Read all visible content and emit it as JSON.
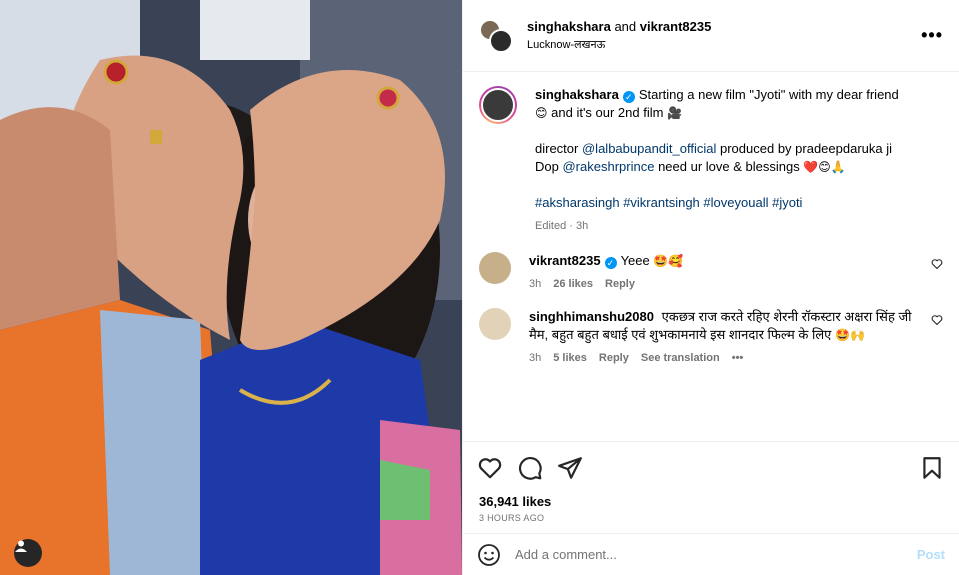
{
  "header": {
    "user1": "singhakshara",
    "and": "and",
    "user2": "vikrant8235",
    "location": "Lucknow-लखनऊ",
    "more": "•••"
  },
  "caption": {
    "username": "singhakshara",
    "line1": "Starting a new film \"Jyoti\" with my dear friend",
    "emoji1": "😊",
    "line1b": "and it's our 2nd film",
    "emoji2": "🎥",
    "director_prefix": "director",
    "director_handle": "@lalbabupandit_official",
    "produced": "produced by pradeepdaruka ji",
    "dop_prefix": "Dop",
    "dop_handle": "@rakeshrprince",
    "dop_suffix": "need ur love & blessings",
    "emoji3": "❤️😊🙏",
    "hashtags": [
      "#aksharasingh",
      "#vikrantsingh",
      "#loveyouall",
      "#jyoti"
    ],
    "edited": "Edited · 3h"
  },
  "comments": [
    {
      "username": "vikrant8235",
      "text": "Yeee",
      "emoji": "🤩🥰",
      "time": "3h",
      "likes": "26 likes",
      "reply": "Reply"
    },
    {
      "username": "singhhimanshu2080",
      "text": "एकछत्र राज करते रहिए शेरनी रॉकस्टार अक्षरा सिंह जी मैम, बहुत बहुत बधाई एवं शुभकामनाये इस शानदार फिल्म के लिए",
      "emoji": "🤩🙌",
      "time": "3h",
      "likes": "5 likes",
      "reply": "Reply",
      "translation": "See translation",
      "more": "•••"
    }
  ],
  "stats": {
    "likes": "36,941 likes",
    "ago": "3 HOURS AGO"
  },
  "add_comment": {
    "placeholder": "Add a comment...",
    "post": "Post"
  },
  "colors": {
    "link": "#00376b",
    "verified": "#0095f6",
    "muted": "#737373",
    "post_disabled": "#b2dffc"
  }
}
